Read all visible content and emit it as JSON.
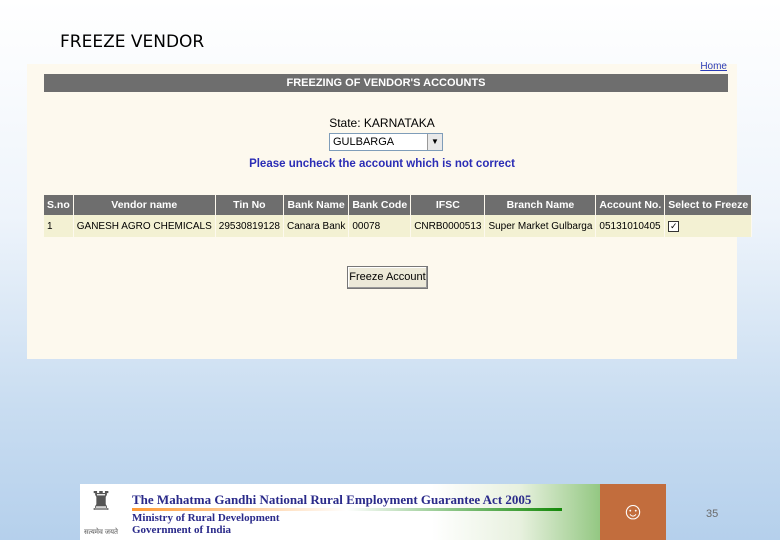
{
  "slide": {
    "title": "FREEZE VENDOR",
    "page_number": "35"
  },
  "app": {
    "home_link": "Home",
    "header": "FREEZING OF VENDOR'S ACCOUNTS",
    "state_label": "State: KARNATAKA",
    "district": {
      "selected": "GULBARGA"
    },
    "instruction": "Please uncheck the account which is not correct",
    "table": {
      "columns": [
        "S.no",
        "Vendor name",
        "Tin No",
        "Bank Name",
        "Bank Code",
        "IFSC",
        "Branch Name",
        "Account No.",
        "Select to Freeze"
      ],
      "rows": [
        {
          "sno": "1",
          "vendor_name": "GANESH AGRO CHEMICALS",
          "tin_no": "29530819128",
          "bank_name": "Canara Bank",
          "bank_code": "00078",
          "ifsc": "CNRB0000513",
          "branch_name": "Super Market Gulbarga",
          "account_no": "05131010405",
          "select_to_freeze": true
        }
      ]
    },
    "freeze_button": "Freeze Account"
  },
  "banner": {
    "title": "The Mahatma Gandhi National Rural Employment Guarantee Act 2005",
    "line1": "Ministry of Rural Development",
    "line2": "Government of India",
    "emblem_caption": "सत्यमेव जयते"
  },
  "icons": {
    "emblem": "national-emblem-icon",
    "portrait": "gandhi-portrait-icon",
    "checkbox": "checkmark-icon"
  }
}
